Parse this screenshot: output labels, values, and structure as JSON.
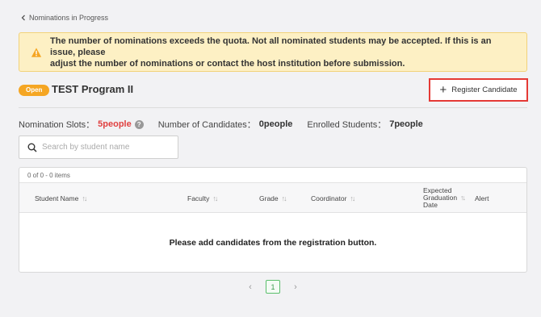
{
  "breadcrumb": {
    "label": "Nominations in Progress"
  },
  "alert": {
    "line1": "The number of nominations exceeds the quota. Not all nominated students may be accepted. If this is an issue, please",
    "line2": "adjust the number of nominations or contact the host institution before submission.",
    "icon": "warning-icon",
    "color": "#f5a623"
  },
  "program": {
    "status": "Open",
    "title": "TEST Program II",
    "register_label": "Register Candidate"
  },
  "stats": {
    "slots_label": "Nomination Slots：",
    "slots_value": "5people",
    "candidates_label": "Number of Candidates：",
    "candidates_value": "0people",
    "enrolled_label": "Enrolled Students：",
    "enrolled_value": "7people"
  },
  "search": {
    "placeholder": "Search by student name",
    "value": ""
  },
  "table": {
    "count": "0 of 0 - 0 items",
    "columns": {
      "student_name": "Student Name",
      "faculty": "Faculty",
      "grade": "Grade",
      "coordinator": "Coordinator",
      "expected_graduation": "Expected Graduation Date",
      "alert": "Alert"
    },
    "empty_message": "Please add candidates from the registration button."
  },
  "pagination": {
    "current_page": "1",
    "prev": "‹",
    "next": "›"
  },
  "colors": {
    "accent_red": "#e53935",
    "badge_orange": "#f5a623",
    "page_green": "#5bbf6c"
  }
}
